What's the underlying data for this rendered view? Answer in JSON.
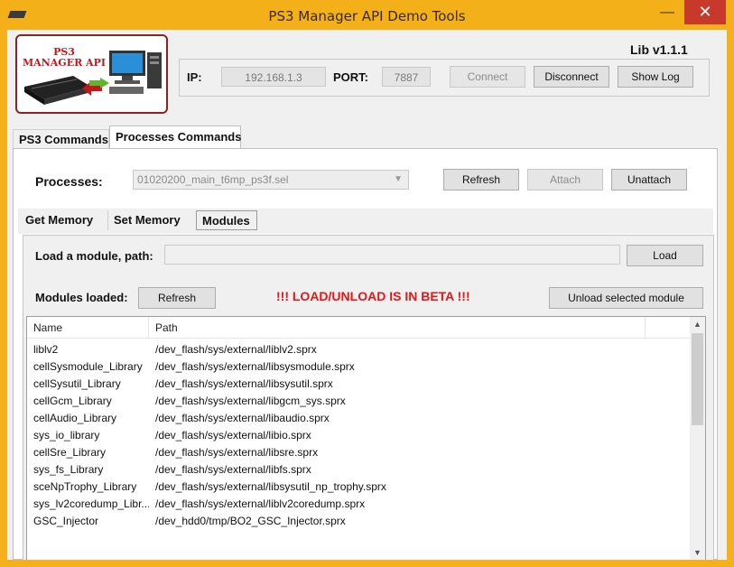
{
  "window": {
    "title": "PS3 Manager API Demo Tools",
    "minimize": "—",
    "maximize": "☐",
    "close": "✕"
  },
  "logo": {
    "text": "PS3 MANAGER API"
  },
  "lib_version": "Lib v1.1.1",
  "connection": {
    "ip_label": "IP:",
    "ip_value": "192.168.1.3",
    "port_label": "PORT:",
    "port_value": "7887",
    "connect": "Connect",
    "disconnect": "Disconnect",
    "show_log": "Show Log"
  },
  "main_tabs": [
    "PS3 Commands",
    "Processes Commands"
  ],
  "processes": {
    "label": "Processes:",
    "selected": "01020200_main_t6mp_ps3f.sel",
    "refresh": "Refresh",
    "attach": "Attach",
    "unattach": "Unattach"
  },
  "sub_tabs": [
    "Get Memory",
    "Set Memory",
    "Modules"
  ],
  "modules": {
    "load_label": "Load a module, path:",
    "path_value": "",
    "load_button": "Load",
    "loaded_label": "Modules loaded:",
    "refresh_button": "Refresh",
    "beta_warning": "!!! LOAD/UNLOAD IS IN BETA !!!",
    "unload_button": "Unload selected module",
    "columns": [
      "Name",
      "Path"
    ],
    "rows": [
      {
        "name": "liblv2",
        "path": "/dev_flash/sys/external/liblv2.sprx"
      },
      {
        "name": "cellSysmodule_Library",
        "path": "/dev_flash/sys/external/libsysmodule.sprx"
      },
      {
        "name": "cellSysutil_Library",
        "path": "/dev_flash/sys/external/libsysutil.sprx"
      },
      {
        "name": "cellGcm_Library",
        "path": "/dev_flash/sys/external/libgcm_sys.sprx"
      },
      {
        "name": "cellAudio_Library",
        "path": "/dev_flash/sys/external/libaudio.sprx"
      },
      {
        "name": "sys_io_library",
        "path": "/dev_flash/sys/external/libio.sprx"
      },
      {
        "name": "cellSre_Library",
        "path": "/dev_flash/sys/external/libsre.sprx"
      },
      {
        "name": "sys_fs_Library",
        "path": "/dev_flash/sys/external/libfs.sprx"
      },
      {
        "name": "sceNpTrophy_Library",
        "path": "/dev_flash/sys/external/libsysutil_np_trophy.sprx"
      },
      {
        "name": "sys_lv2coredump_Libr...",
        "path": "/dev_flash/sys/external/liblv2coredump.sprx"
      },
      {
        "name": "GSC_Injector",
        "path": "/dev_hdd0/tmp/BO2_GSC_Injector.sprx"
      }
    ]
  },
  "colors": {
    "frame": "#f5b11c",
    "close": "#c7392b",
    "warning": "#e01818",
    "logo_border": "#8d2222"
  }
}
